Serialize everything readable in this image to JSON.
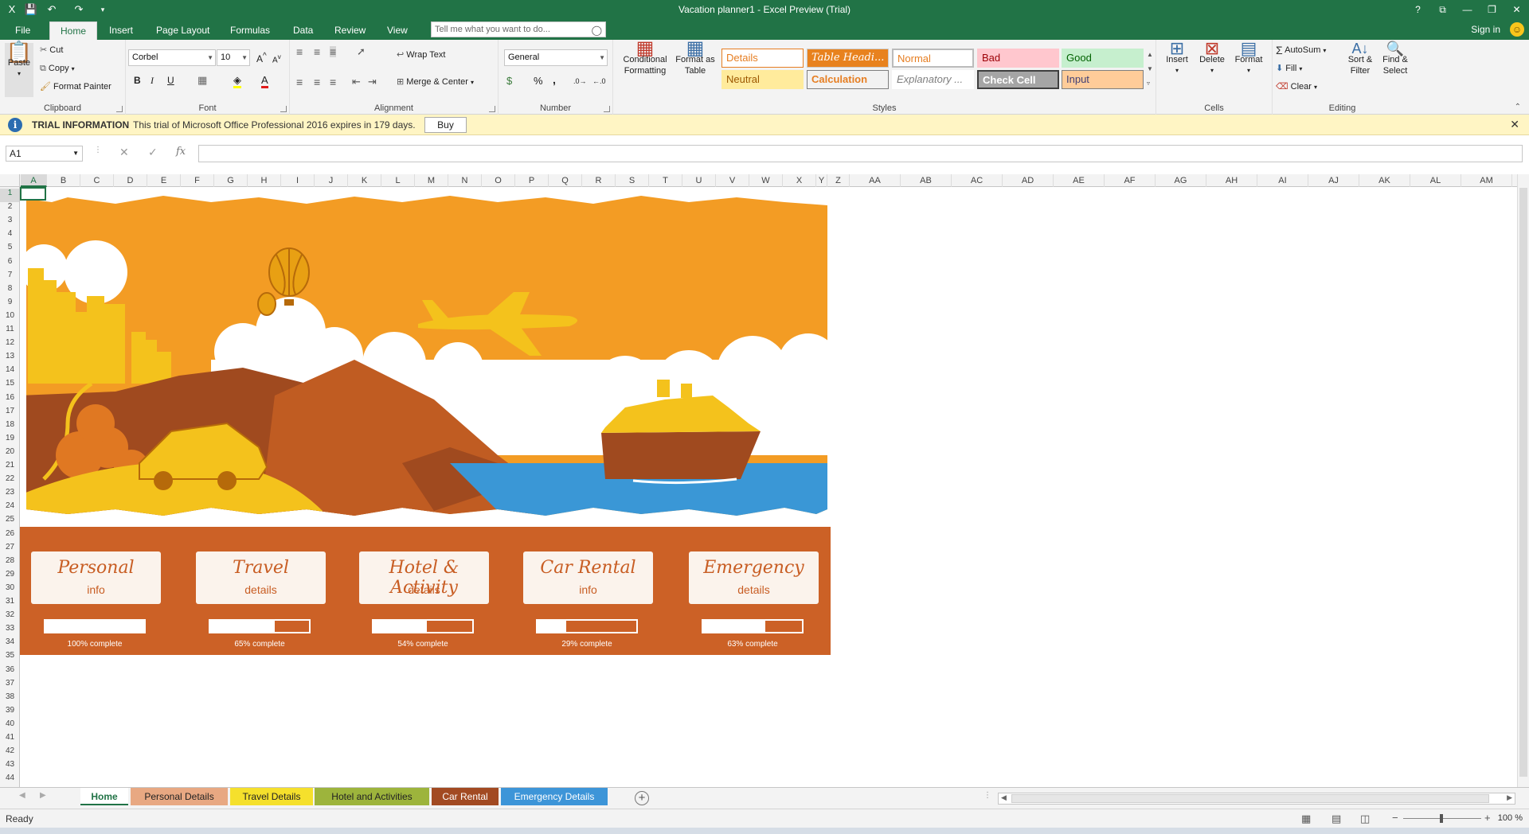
{
  "window": {
    "title": "Vacation planner1 - Excel Preview (Trial)",
    "controls": [
      "?",
      "⧉",
      "—",
      "❐",
      "✕"
    ]
  },
  "menu": {
    "tabs": [
      "File",
      "Home",
      "Insert",
      "Page Layout",
      "Formulas",
      "Data",
      "Review",
      "View"
    ],
    "active": "Home",
    "tell_me_placeholder": "Tell me what you want to do...",
    "sign_in": "Sign in"
  },
  "ribbon": {
    "clipboard": {
      "paste": "Paste",
      "cut": "Cut",
      "copy": "Copy",
      "format_painter": "Format Painter",
      "label": "Clipboard"
    },
    "font": {
      "name": "Corbel",
      "size": "10",
      "bold": "B",
      "italic": "I",
      "underline": "U",
      "label": "Font"
    },
    "alignment": {
      "wrap_text": "Wrap Text",
      "merge_center": "Merge & Center",
      "label": "Alignment"
    },
    "number": {
      "format": "General",
      "percent": "%",
      "comma": ",",
      "label": "Number"
    },
    "styles": {
      "conditional_formatting": "Conditional Formatting",
      "format_as_table": "Format as Table",
      "cells": [
        "Details",
        "Table Headi...",
        "Normal",
        "Bad",
        "Good",
        "Neutral",
        "Calculation",
        "Explanatory ...",
        "Check Cell",
        "Input"
      ],
      "label": "Styles"
    },
    "cells": {
      "insert": "Insert",
      "delete": "Delete",
      "format": "Format",
      "label": "Cells"
    },
    "editing": {
      "autosum": "AutoSum",
      "fill": "Fill",
      "clear": "Clear",
      "sort_filter": "Sort & Filter",
      "find_select": "Find & Select",
      "label": "Editing"
    }
  },
  "trial": {
    "title": "TRIAL INFORMATION",
    "message": "This trial of Microsoft Office Professional 2016 expires in 179 days.",
    "buy": "Buy"
  },
  "formula_bar": {
    "name_box": "A1",
    "fx": "fx",
    "value": ""
  },
  "columns": [
    "A",
    "B",
    "C",
    "D",
    "E",
    "F",
    "G",
    "H",
    "I",
    "J",
    "K",
    "L",
    "M",
    "N",
    "O",
    "P",
    "Q",
    "R",
    "S",
    "T",
    "U",
    "V",
    "W",
    "X",
    "Y",
    "Z",
    "AA",
    "AB",
    "AC",
    "AD",
    "AE",
    "AF",
    "AG",
    "AH",
    "AI",
    "AJ",
    "AK",
    "AL",
    "AM"
  ],
  "rows": [
    "1",
    "2",
    "3",
    "4",
    "5",
    "6",
    "7",
    "8",
    "9",
    "10",
    "11",
    "12",
    "13",
    "14",
    "15",
    "16",
    "17",
    "18",
    "19",
    "20",
    "21",
    "22",
    "23",
    "24",
    "25",
    "26",
    "27",
    "28",
    "29",
    "30",
    "31",
    "32",
    "33",
    "34",
    "35",
    "36",
    "37",
    "38",
    "39",
    "40",
    "41",
    "42",
    "43",
    "44"
  ],
  "tiles": [
    {
      "title": "Personal",
      "sub": "info",
      "progress": 1.0,
      "label": "100% complete"
    },
    {
      "title": "Travel",
      "sub": "details",
      "progress": 0.65,
      "label": "65% complete"
    },
    {
      "title": "Hotel & Activity",
      "sub": "details",
      "progress": 0.54,
      "label": "54% complete"
    },
    {
      "title": "Car Rental",
      "sub": "info",
      "progress": 0.29,
      "label": "29% complete"
    },
    {
      "title": "Emergency",
      "sub": "details",
      "progress": 0.63,
      "label": "63% complete"
    }
  ],
  "sheet_tabs": [
    {
      "label": "Home",
      "color": "#ffffff",
      "active": true
    },
    {
      "label": "Personal Details",
      "color": "#e8a882"
    },
    {
      "label": "Travel Details",
      "color": "#f5e02c"
    },
    {
      "label": "Hotel and Activities",
      "color": "#9db43c"
    },
    {
      "label": "Car Rental",
      "color": "#a24a22"
    },
    {
      "label": "Emergency Details",
      "color": "#3d95d8"
    }
  ],
  "status": {
    "ready": "Ready",
    "zoom": "100 %"
  },
  "colors": {
    "excel_green": "#217346",
    "banner_orange": "#f39c24",
    "tile_bg": "#cc6126",
    "sea_blue": "#3a97d6"
  }
}
